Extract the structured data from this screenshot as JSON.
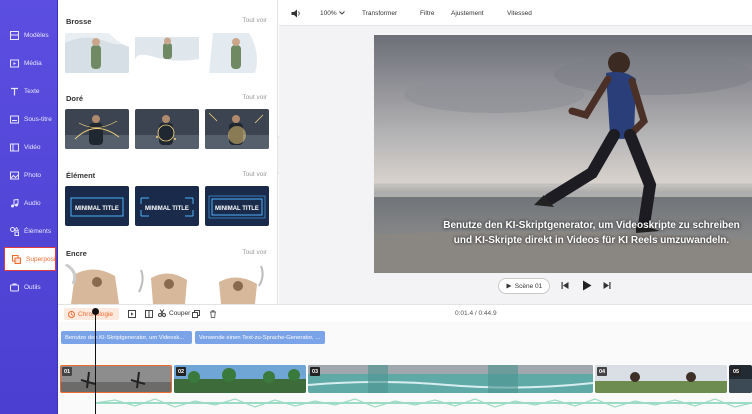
{
  "sidebar": {
    "items": [
      {
        "label": "Modèles",
        "icon": "templates-icon"
      },
      {
        "label": "Média",
        "icon": "media-icon"
      },
      {
        "label": "Texte",
        "icon": "text-icon"
      },
      {
        "label": "Sous-titre",
        "icon": "subtitle-icon"
      },
      {
        "label": "Vidéo",
        "icon": "video-icon"
      },
      {
        "label": "Photo",
        "icon": "photo-icon"
      },
      {
        "label": "Audio",
        "icon": "audio-icon"
      },
      {
        "label": "Éléments",
        "icon": "elements-icon"
      },
      {
        "label": "Superposi",
        "icon": "overlay-icon"
      },
      {
        "label": "Outils",
        "icon": "tools-icon"
      }
    ],
    "active": "Superposi"
  },
  "panel": {
    "sections": [
      {
        "title": "Brosse",
        "more": "Tout voir"
      },
      {
        "title": "Doré",
        "more": "Tout voir"
      },
      {
        "title": "Élément",
        "more": "Tout voir",
        "thumb_text": "MINIMAL TITLE"
      },
      {
        "title": "Encre",
        "more": "Tout voir"
      }
    ]
  },
  "toolbar": {
    "zoom": "100%",
    "items": [
      "Transformer",
      "Filtre",
      "Ajustement",
      "Vitessed"
    ]
  },
  "preview": {
    "subtitle": "Benutze den KI-Skriptgenerator, um Videoskripte zu schreiben und KI-Skripte direkt in Videos für KI Reels umzuwandeln.",
    "scene_label": "Scène 01"
  },
  "timeline": {
    "chronology_label": "Chronologie",
    "cut_label": "Couper",
    "time": "0:01.4 / 0:44.9",
    "subtitle_clips": [
      "Benutze den KI-Skriptgenerator, um Videosk...",
      "Verwende einen Text-zu-Sprache-Generator, ..."
    ],
    "clip_numbers": [
      "01",
      "02",
      "03",
      "04",
      "05"
    ]
  },
  "colors": {
    "sidebar": "#4f43d9",
    "accent": "#f06a2e",
    "subtitle_clip": "#7aa3e8",
    "audio_wave": "#9ddcc4"
  }
}
